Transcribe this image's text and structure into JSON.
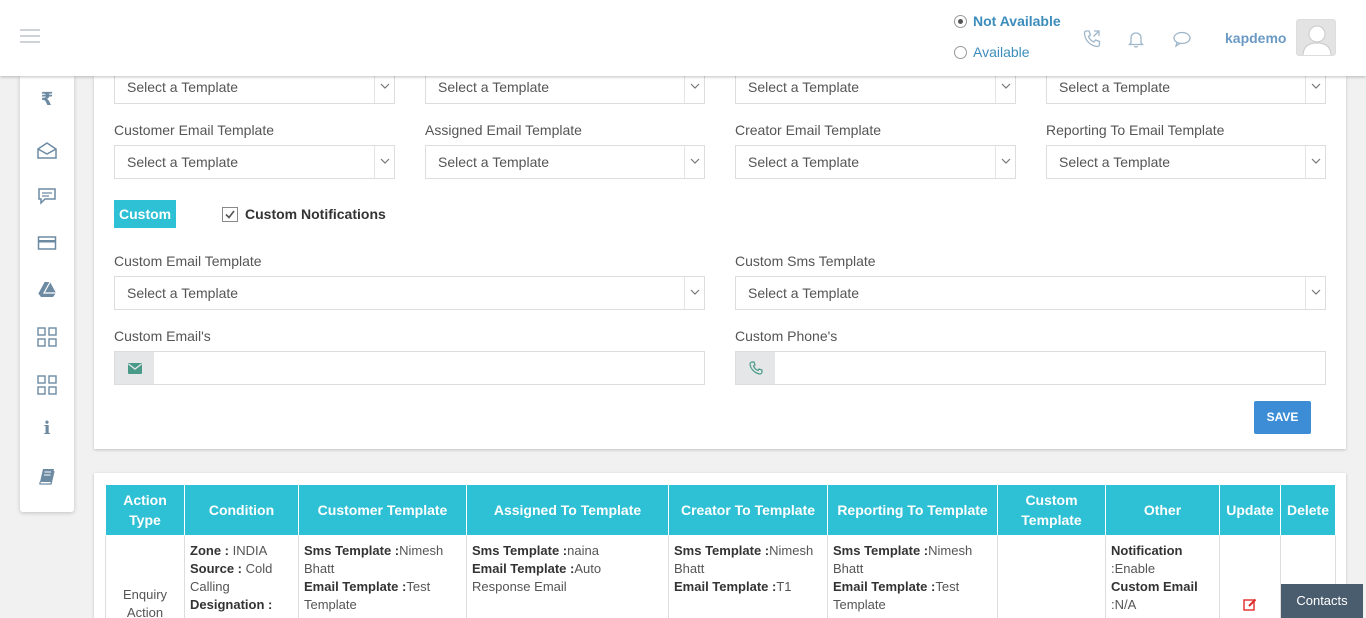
{
  "header": {
    "status_options": [
      {
        "label": "Not Available",
        "selected": true
      },
      {
        "label": "Available",
        "selected": false
      }
    ],
    "user_name": "kapdemo",
    "icons": [
      "menu-icon",
      "phone-icon",
      "bell-icon",
      "chat-icon",
      "avatar"
    ]
  },
  "sidebar": {
    "icons": [
      "rupee-icon",
      "mail-open-icon",
      "comment-icon",
      "card-icon",
      "drive-icon",
      "grid-icon",
      "grid-icon",
      "info-icon",
      "book-icon"
    ]
  },
  "form": {
    "top_row_selects": [
      "Select a Template",
      "Select a Template",
      "Select a Template",
      "Select a Template"
    ],
    "email_templates": [
      {
        "label": "Customer Email Template",
        "value": "Select a Template"
      },
      {
        "label": "Assigned Email Template",
        "value": "Select a Template"
      },
      {
        "label": "Creator Email Template",
        "value": "Select a Template"
      },
      {
        "label": "Reporting To Email Template",
        "value": "Select a Template"
      }
    ],
    "custom_badge": "Custom",
    "custom_notifications_label": "Custom Notifications",
    "custom_notifications_checked": true,
    "custom_email_template": {
      "label": "Custom Email Template",
      "value": "Select a Template"
    },
    "custom_sms_template": {
      "label": "Custom Sms Template",
      "value": "Select a Template"
    },
    "custom_emails": {
      "label": "Custom Email's",
      "value": ""
    },
    "custom_phones": {
      "label": "Custom Phone's",
      "value": ""
    },
    "save_label": "SAVE"
  },
  "table": {
    "headers": [
      "Action Type",
      "Condition",
      "Customer Template",
      "Assigned To Template",
      "Creator To Template",
      "Reporting To Template",
      "Custom Template",
      "Other",
      "Update",
      "Delete"
    ],
    "row": {
      "action_type": "Enquiry Action",
      "condition": {
        "zone_label": "Zone :",
        "zone": " INDIA",
        "source_label": "Source :",
        "source": " Cold Calling",
        "designation_label": "Designation :"
      },
      "customer": {
        "sms_label": "Sms Template :",
        "sms": "Nimesh Bhatt",
        "email_label": "Email Template :",
        "email": "Test Template"
      },
      "assigned": {
        "sms_label": "Sms Template :",
        "sms": "naina",
        "email_label": "Email Template :",
        "email": "Auto Response Email"
      },
      "creator": {
        "sms_label": "Sms Template :",
        "sms": "Nimesh Bhatt",
        "email_label": "Email Template :",
        "email": "T1"
      },
      "reporting": {
        "sms_label": "Sms Template :",
        "sms": "Nimesh Bhatt",
        "email_label": "Email Template :",
        "email": "Test Template"
      },
      "custom": "",
      "other": {
        "notification_label": "Notification",
        "notification": ":Enable",
        "custom_email_label": "Custom Email",
        "custom_email": ":N/A"
      }
    }
  },
  "contacts_button": "Contacts",
  "colors": {
    "accent": "#2ec0d4",
    "primary": "#3c8dd6",
    "link": "#3c8dbc"
  }
}
